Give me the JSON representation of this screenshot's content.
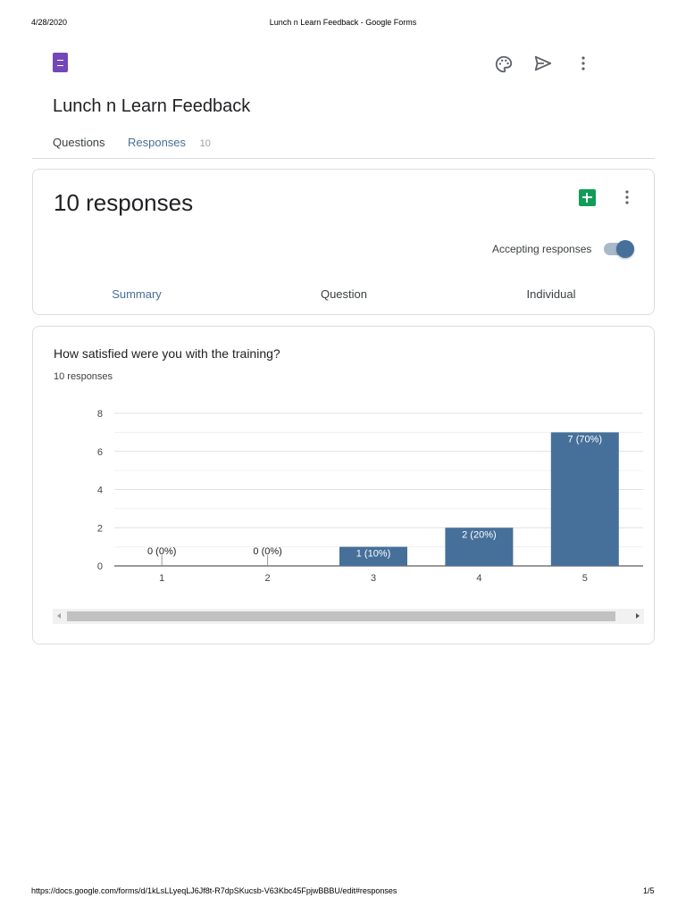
{
  "print_header": {
    "date": "4/28/2020",
    "title": "Lunch n Learn Feedback - Google Forms"
  },
  "print_footer": {
    "url": "https://docs.google.com/forms/d/1kLsLLyeqLJ6Jf8t-R7dpSKucsb-V63Kbc45FpjwBBBU/edit#responses",
    "page": "1/5"
  },
  "form": {
    "title": "Lunch n Learn Feedback"
  },
  "tabs": [
    {
      "label": "Questions"
    },
    {
      "label": "Responses",
      "count": "10"
    }
  ],
  "responses_card": {
    "heading": "10 responses",
    "accepting_label": "Accepting responses",
    "accepting": true,
    "subtabs": [
      "Summary",
      "Question",
      "Individual"
    ]
  },
  "question": {
    "title": "How satisfied were you with the training?",
    "count_label": "10 responses"
  },
  "colors": {
    "bar": "#46709a",
    "accent": "#4285f4",
    "tab_active": "#4a6f96"
  },
  "chart_data": {
    "type": "bar",
    "categories": [
      "1",
      "2",
      "3",
      "4",
      "5"
    ],
    "values": [
      0,
      0,
      1,
      2,
      7
    ],
    "labels": [
      "0 (0%)",
      "0 (0%)",
      "1 (10%)",
      "2 (20%)",
      "7 (70%)"
    ],
    "yticks": [
      "0",
      "2",
      "4",
      "6",
      "8"
    ],
    "ylim": [
      0,
      8
    ],
    "grid": true
  }
}
